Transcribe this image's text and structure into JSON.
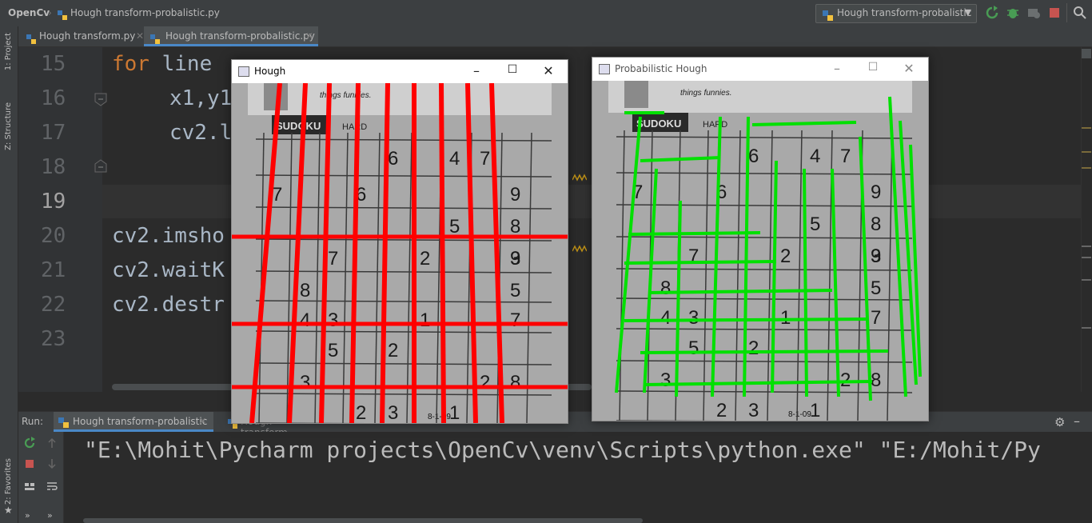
{
  "breadcrumb": {
    "project": "OpenCv",
    "file": "Hough transform-probalistic.py"
  },
  "run_config": {
    "label": "Hough transform-probalistic"
  },
  "tool_strip": {
    "project": "1: Project",
    "structure": "Z: Structure",
    "favorites": "2: Favorites"
  },
  "editor_tabs": [
    {
      "label": "Hough transform.py"
    },
    {
      "label": "Hough transform-probalistic.py"
    }
  ],
  "editor": {
    "line_numbers": [
      "15",
      "16",
      "17",
      "18",
      "19",
      "20",
      "21",
      "22",
      "23"
    ],
    "lines": [
      {
        "kw": "for",
        "rest": " line"
      },
      {
        "kw": "",
        "rest": "x1,y1"
      },
      {
        "kw": "",
        "rest": "cv2.l"
      },
      {
        "kw": "",
        "rest": "cv2.imsho"
      },
      {
        "kw": "",
        "rest": "cv2.waitK"
      },
      {
        "kw": "",
        "rest": "cv2.destr"
      }
    ]
  },
  "run_panel": {
    "label": "Run:",
    "tabs": [
      {
        "label": "Hough transform-probalistic"
      },
      {
        "label": "Hough transform"
      }
    ],
    "command": "\"E:\\Mohit\\Pycharm projects\\OpenCv\\venv\\Scripts\\python.exe\" \"E:/Mohit/Py"
  },
  "windows": [
    {
      "title": "Hough",
      "line_color": "#ff0000",
      "image_digits": [
        "6",
        "4",
        "7",
        "7",
        "6",
        "9",
        "5",
        "8",
        "7",
        "2",
        "9",
        "3",
        "8",
        "5",
        "4",
        "3",
        "1",
        "7",
        "5",
        "2",
        "3",
        "2",
        "8",
        "2",
        "3",
        "1"
      ]
    },
    {
      "title": "Probabilistic Hough",
      "line_color": "#00e000",
      "image_digits": [
        "6",
        "4",
        "7",
        "7",
        "6",
        "9",
        "5",
        "8",
        "7",
        "2",
        "9",
        "3",
        "8",
        "5",
        "4",
        "3",
        "1",
        "7",
        "5",
        "2",
        "3",
        "2",
        "8",
        "2",
        "3",
        "1"
      ]
    }
  ],
  "sudoku_header": {
    "brand": "SUDOKU",
    "level": "HARD",
    "caption": "things funnies.",
    "date": "8-1-09"
  },
  "icons": {
    "run": "rerun-icon",
    "stop": "stop-icon",
    "debug": "bug-icon",
    "search": "search-icon",
    "settings": "gear-icon",
    "python": "python-file-icon"
  },
  "colors": {
    "accent": "#4a88c7",
    "keyword": "#cc7832",
    "stop": "#c75450",
    "run": "#499c54"
  }
}
